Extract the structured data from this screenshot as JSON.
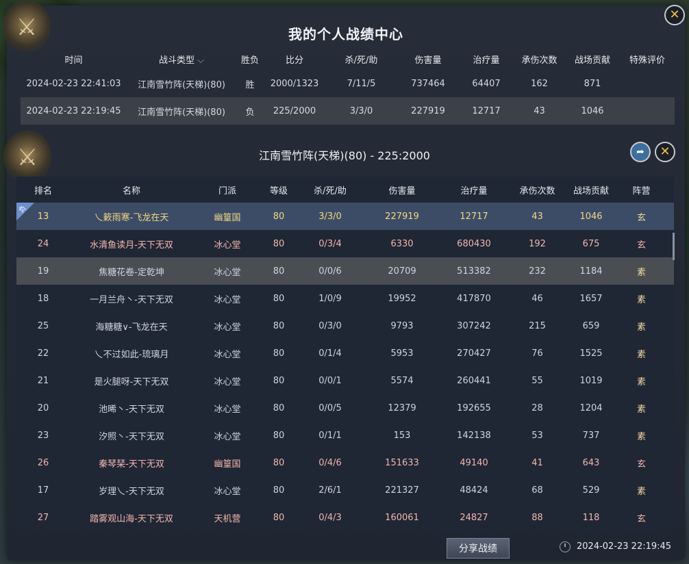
{
  "window": {
    "title": "我的个人战绩中心"
  },
  "top": {
    "headers": [
      "时间",
      "战斗类型",
      "胜负",
      "比分",
      "杀/死/助",
      "伤害量",
      "治疗量",
      "承伤次数",
      "战场贡献",
      "特殊评价"
    ],
    "rows": [
      {
        "time": "2024-02-23 22:41:03",
        "type": "江南雪竹阵(天梯)(80)",
        "result": "胜",
        "score": "2000/1323",
        "kda": "7/11/5",
        "damage": "737464",
        "healing": "64407",
        "hits": "162",
        "contribution": "871",
        "special": ""
      },
      {
        "time": "2024-02-23 22:19:45",
        "type": "江南雪竹阵(天梯)(80)",
        "result": "负",
        "score": "225/2000",
        "kda": "3/3/0",
        "damage": "227919",
        "healing": "12717",
        "hits": "43",
        "contribution": "1046",
        "special": ""
      }
    ]
  },
  "detail": {
    "title": "江南雪竹阵(天梯)(80) - 225:2000",
    "headers": [
      "排名",
      "名称",
      "门派",
      "等级",
      "杀/死/助",
      "伤害量",
      "治疗量",
      "承伤次数",
      "战场贡献",
      "阵营"
    ],
    "self_badge": "负",
    "rows": [
      {
        "rank": "13",
        "name": "乀簌雨寒-飞龙在天",
        "sect": "幽篁国",
        "level": "80",
        "kda": "3/3/0",
        "damage": "227919",
        "healing": "12717",
        "hits": "43",
        "contribution": "1046",
        "camp": "玄",
        "style": "self"
      },
      {
        "rank": "24",
        "name": "水清鱼读月-天下无双",
        "sect": "冰心堂",
        "level": "80",
        "kda": "0/3/4",
        "damage": "6330",
        "healing": "680430",
        "hits": "192",
        "contribution": "675",
        "camp": "玄",
        "style": "pink"
      },
      {
        "rank": "19",
        "name": "焦糖花卷-定乾坤",
        "sect": "冰心堂",
        "level": "80",
        "kda": "0/0/6",
        "damage": "20709",
        "healing": "513382",
        "hits": "232",
        "contribution": "1184",
        "camp": "素",
        "style": "hl"
      },
      {
        "rank": "18",
        "name": "一月兰舟丶-天下无双",
        "sect": "冰心堂",
        "level": "80",
        "kda": "1/0/9",
        "damage": "19952",
        "healing": "417870",
        "hits": "46",
        "contribution": "1657",
        "camp": "素",
        "style": ""
      },
      {
        "rank": "25",
        "name": "海糖糖∨-飞龙在天",
        "sect": "冰心堂",
        "level": "80",
        "kda": "0/3/0",
        "damage": "9793",
        "healing": "307242",
        "hits": "215",
        "contribution": "659",
        "camp": "素",
        "style": ""
      },
      {
        "rank": "22",
        "name": "乀不过如此-琉璃月",
        "sect": "冰心堂",
        "level": "80",
        "kda": "0/1/4",
        "damage": "5953",
        "healing": "270427",
        "hits": "76",
        "contribution": "1525",
        "camp": "素",
        "style": ""
      },
      {
        "rank": "21",
        "name": "是火腿呀-天下无双",
        "sect": "冰心堂",
        "level": "80",
        "kda": "0/0/1",
        "damage": "5574",
        "healing": "260441",
        "hits": "55",
        "contribution": "1019",
        "camp": "素",
        "style": ""
      },
      {
        "rank": "20",
        "name": "池晞丶-天下无双",
        "sect": "冰心堂",
        "level": "80",
        "kda": "0/0/5",
        "damage": "12379",
        "healing": "192655",
        "hits": "28",
        "contribution": "1204",
        "camp": "素",
        "style": ""
      },
      {
        "rank": "23",
        "name": "汐照丶-天下无双",
        "sect": "冰心堂",
        "level": "80",
        "kda": "0/1/1",
        "damage": "153",
        "healing": "142138",
        "hits": "53",
        "contribution": "737",
        "camp": "素",
        "style": ""
      },
      {
        "rank": "26",
        "name": "秦琴琹-天下无双",
        "sect": "幽篁国",
        "level": "80",
        "kda": "0/4/6",
        "damage": "151633",
        "healing": "49140",
        "hits": "41",
        "contribution": "643",
        "camp": "玄",
        "style": "pink"
      },
      {
        "rank": "17",
        "name": "岁理乀-天下无双",
        "sect": "冰心堂",
        "level": "80",
        "kda": "2/6/1",
        "damage": "221327",
        "healing": "48424",
        "hits": "68",
        "contribution": "529",
        "camp": "素",
        "style": ""
      },
      {
        "rank": "27",
        "name": "踏雾观山海-天下无双",
        "sect": "天机营",
        "level": "80",
        "kda": "0/4/3",
        "damage": "160061",
        "healing": "24827",
        "hits": "88",
        "contribution": "118",
        "camp": "玄",
        "style": "pink"
      }
    ]
  },
  "footer": {
    "share_label": "分享战绩",
    "time": "2024-02-23 22:19:45"
  }
}
